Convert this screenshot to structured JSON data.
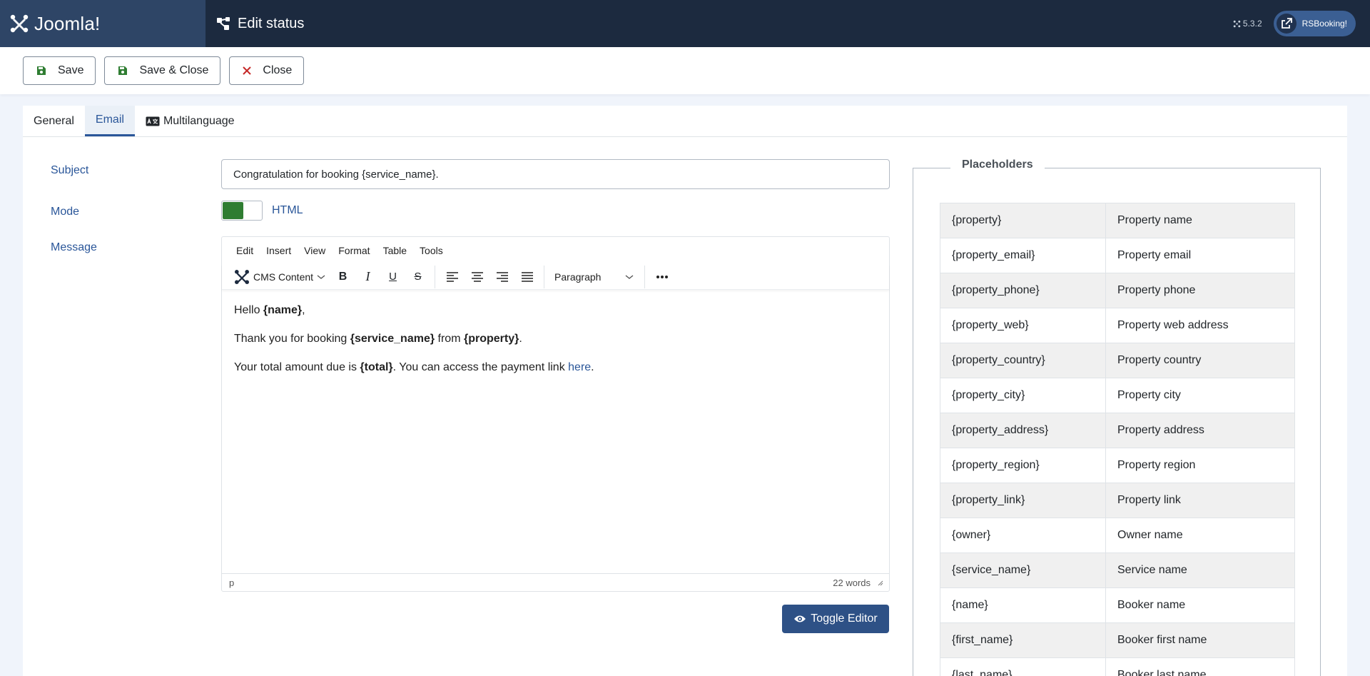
{
  "header": {
    "logo_text": "Joomla!",
    "page_title": "Edit status",
    "version": "5.3.2",
    "extension_button": "RSBooking!"
  },
  "toolbar": {
    "save_label": "Save",
    "save_close_label": "Save & Close",
    "close_label": "Close"
  },
  "tabs": [
    {
      "label": "General",
      "active": false
    },
    {
      "label": "Email",
      "active": true
    },
    {
      "label": "Multilanguage",
      "active": false
    }
  ],
  "form": {
    "subject_label": "Subject",
    "subject_value": "Congratulation for booking {service_name}.",
    "mode_label": "Mode",
    "mode_value": "HTML",
    "message_label": "Message"
  },
  "editor": {
    "menu": [
      "Edit",
      "Insert",
      "View",
      "Format",
      "Table",
      "Tools"
    ],
    "cms_content_label": "CMS Content",
    "paragraph_label": "Paragraph",
    "content": {
      "line1_prefix": "Hello ",
      "line1_bold": "{name}",
      "line1_suffix": ",",
      "line2_prefix": "Thank you for booking ",
      "line2_bold1": "{service_name}",
      "line2_mid": " from ",
      "line2_bold2": "{property}",
      "line2_suffix": ".",
      "line3_prefix": "Your total amount due is ",
      "line3_bold": "{total}",
      "line3_mid": ". You can access the payment link ",
      "line3_link": "here",
      "line3_suffix": "."
    },
    "status_path": "p",
    "word_count": "22 words"
  },
  "toggle_editor_label": "Toggle Editor",
  "placeholders": {
    "title": "Placeholders",
    "rows": [
      {
        "key": "{property}",
        "desc": "Property name"
      },
      {
        "key": "{property_email}",
        "desc": "Property email"
      },
      {
        "key": "{property_phone}",
        "desc": "Property phone"
      },
      {
        "key": "{property_web}",
        "desc": "Property web address"
      },
      {
        "key": "{property_country}",
        "desc": "Property country"
      },
      {
        "key": "{property_city}",
        "desc": "Property city"
      },
      {
        "key": "{property_address}",
        "desc": "Property address"
      },
      {
        "key": "{property_region}",
        "desc": "Property region"
      },
      {
        "key": "{property_link}",
        "desc": "Property link"
      },
      {
        "key": "{owner}",
        "desc": "Owner name"
      },
      {
        "key": "{service_name}",
        "desc": "Service name"
      },
      {
        "key": "{name}",
        "desc": "Booker name"
      },
      {
        "key": "{first_name}",
        "desc": "Booker first name"
      },
      {
        "key": "{last_name}",
        "desc": "Booker last name"
      }
    ]
  },
  "colors": {
    "header_bg": "#1c2a3f",
    "logo_bg": "#2e4566",
    "accent": "#2a5699",
    "switch_on": "#2f7d32",
    "toggle_button": "#2e5186"
  }
}
